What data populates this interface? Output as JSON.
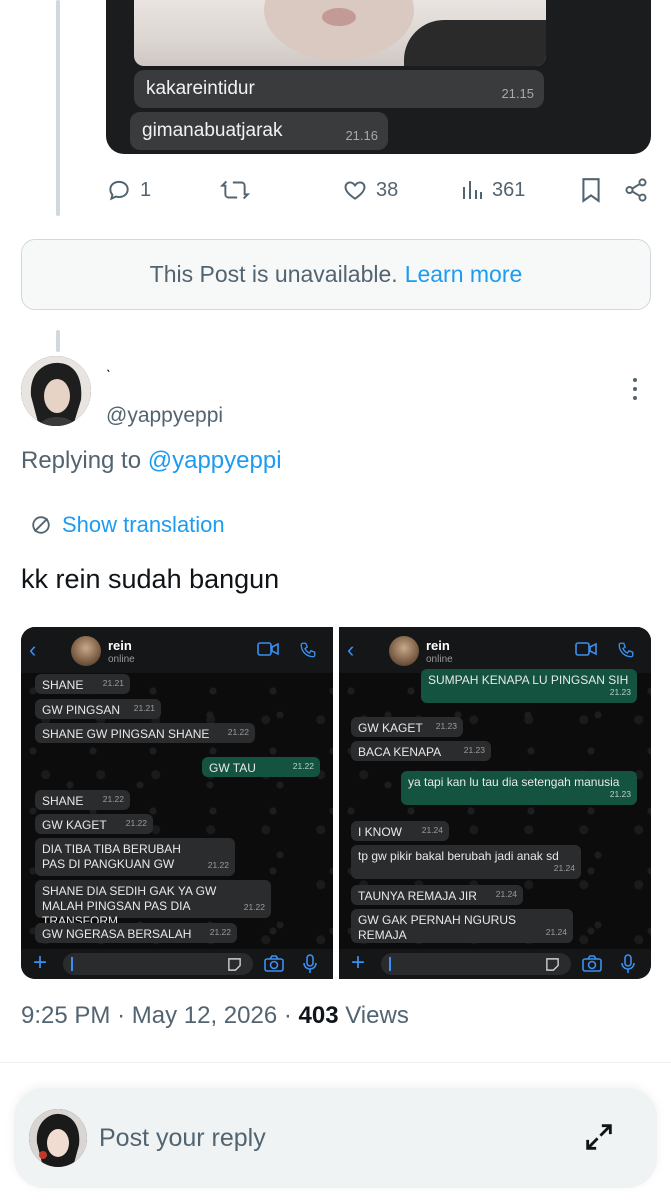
{
  "top_chat": {
    "messages": [
      {
        "text": "kakareintidur",
        "time": "21.15"
      },
      {
        "text": "gimanabuatjarak",
        "time": "21.16"
      }
    ]
  },
  "actions": {
    "replies": "1",
    "retweets": "",
    "likes": "38",
    "views": "361"
  },
  "unavailable": {
    "text": "This Post is unavailable.",
    "link": "Learn more"
  },
  "author": {
    "display_name": "ˎ",
    "handle": "@yappyeppi"
  },
  "replying": {
    "prefix": "Replying to",
    "to": "@yappyeppi"
  },
  "translate_label": "Show translation",
  "post_text": "kk rein sudah bangun",
  "shots": {
    "contact_name": "rein",
    "contact_status": "online",
    "left": [
      {
        "text": "SHANE",
        "time": "21.21"
      },
      {
        "text": "GW PINGSAN",
        "time": "21.21"
      },
      {
        "text": "SHANE GW PINGSAN SHANE",
        "time": "21.22"
      },
      {
        "text": "GW TAU",
        "time": "21.22"
      },
      {
        "text": "SHANE",
        "time": "21.22"
      },
      {
        "text": "GW KAGET",
        "time": "21.22"
      },
      {
        "text": "DIA TIBA TIBA BERUBAH PAS DI PANGKUAN GW",
        "time": "21.22"
      },
      {
        "text": "SHANE DIA SEDIH GAK YA GW MALAH PINGSAN PAS DIA TRANSFORM",
        "time": "21.22"
      },
      {
        "text": "GW NGERASA BERSALAH",
        "time": "21.22"
      }
    ],
    "right": [
      {
        "text": "SUMPAH KENAPA LU PINGSAN SIH",
        "time": "21.23"
      },
      {
        "text": "GW KAGET",
        "time": "21.23"
      },
      {
        "text": "BACA KENAPA",
        "time": "21.23"
      },
      {
        "text": "ya tapi kan lu tau dia setengah manusia",
        "time": "21.23"
      },
      {
        "text": "I KNOW",
        "time": "21.24"
      },
      {
        "text": "tp gw pikir bakal berubah jadi anak sd",
        "time": "21.24"
      },
      {
        "text": "TAUNYA REMAJA JIR",
        "time": "21.24"
      },
      {
        "text": "GW GAK PERNAH NGURUS REMAJA",
        "time": "21.24"
      }
    ]
  },
  "meta": {
    "time": "9:25 PM",
    "sep1": "·",
    "date": "May 12, 2026",
    "sep2": "·",
    "views_count": "403",
    "views_label": "Views"
  },
  "composer": {
    "placeholder": "Post your reply"
  },
  "colors": {
    "link": "#1d9bf0",
    "muted": "#536471",
    "wa_out": "#13533f",
    "wa_accent": "#3b8ff0"
  }
}
